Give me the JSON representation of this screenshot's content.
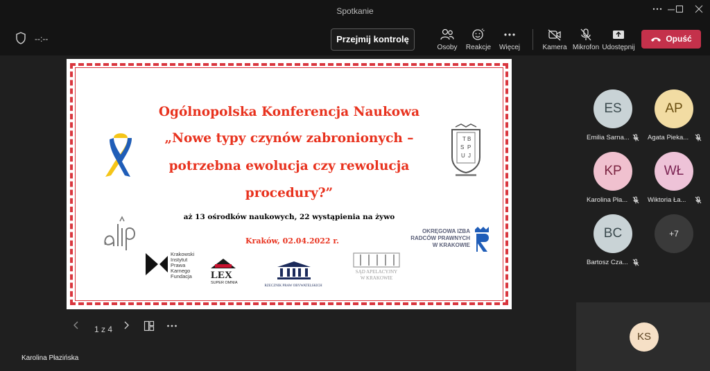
{
  "window": {
    "title": "Spotkanie"
  },
  "toolbar": {
    "timer": "--:--",
    "take_control": "Przejmij kontrolę",
    "people": "Osoby",
    "reactions": "Reakcje",
    "more": "Więcej",
    "camera": "Kamera",
    "mic": "Mikrofon",
    "share": "Udostępnij",
    "leave": "Opuść"
  },
  "slide": {
    "title_lines": [
      "Ogólnopolska Konferencja Naukowa",
      "„Nowe typy czynów zabronionych –",
      "potrzebna ewolucja czy rewolucja",
      "procedury?”"
    ],
    "subtitle": "aż 13 ośrodków naukowych, 22 wystąpienia na żywo",
    "date": "Kraków, 02.04.2022 r.",
    "logos": {
      "kikf": [
        "Krakowski",
        "Instytut",
        "Prawa",
        "Karnego",
        "Fundacja"
      ],
      "lex_main": "LEX",
      "lex_sub": "SUPER OMNIA",
      "rpo": "RZECZNIK PRAW OBYWATELSKICH",
      "sad": [
        "SĄD APELACYJNY",
        "W KRAKOWIE"
      ],
      "oirp": [
        "OKRĘGOWA IZBA",
        "RADCÓW PRAWNYCH",
        "W KRAKOWIE"
      ],
      "tbs": [
        "T",
        "B",
        "S",
        "P",
        "U",
        "J"
      ]
    }
  },
  "slide_controls": {
    "page": "1 z 4"
  },
  "participants": [
    {
      "initials": "ES",
      "name": "Emilia Sarna...",
      "bg": "#c9d3d6",
      "fg": "#3b4a4e"
    },
    {
      "initials": "AP",
      "name": "Agata Pieka...",
      "bg": "#f2dca3",
      "fg": "#6a4e10"
    },
    {
      "initials": "KP",
      "name": "Karolina Pła...",
      "bg": "#f0c1cf",
      "fg": "#7a2340"
    },
    {
      "initials": "WŁ",
      "name": "Wiktoria Ła...",
      "bg": "#eec3d8",
      "fg": "#7a2352"
    },
    {
      "initials": "BC",
      "name": "Bartosz Cza...",
      "bg": "#c9d3d6",
      "fg": "#3b4a4e"
    }
  ],
  "more_participants": "+7",
  "self": {
    "initials": "KS",
    "bg": "#f6e0c6",
    "fg": "#5c4322"
  },
  "presenter_name": "Karolina Płazińska",
  "colors": {
    "accent_red": "#c4314b",
    "slide_red": "#e8321e"
  }
}
